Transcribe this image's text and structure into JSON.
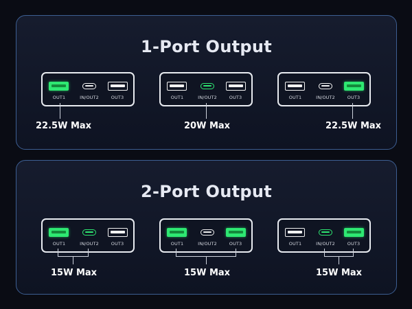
{
  "sections": [
    {
      "title": "1-Port Output",
      "groups": [
        {
          "active": [
            "OUT1"
          ],
          "power": "22.5W Max"
        },
        {
          "active": [
            "IN/OUT2"
          ],
          "power": "20W Max"
        },
        {
          "active": [
            "OUT3"
          ],
          "power": "22.5W Max"
        }
      ]
    },
    {
      "title": "2-Port Output",
      "groups": [
        {
          "active": [
            "OUT1",
            "IN/OUT2"
          ],
          "power": "15W Max"
        },
        {
          "active": [
            "OUT1",
            "OUT3"
          ],
          "power": "15W Max"
        },
        {
          "active": [
            "IN/OUT2",
            "OUT3"
          ],
          "power": "15W Max"
        }
      ]
    }
  ],
  "port_labels": {
    "out1": "OUT1",
    "inout2": "IN/OUT2",
    "out3": "OUT3"
  },
  "colors": {
    "active": "#2ee872",
    "panel_border": "#3d5f93",
    "background": "#0a0c14"
  }
}
